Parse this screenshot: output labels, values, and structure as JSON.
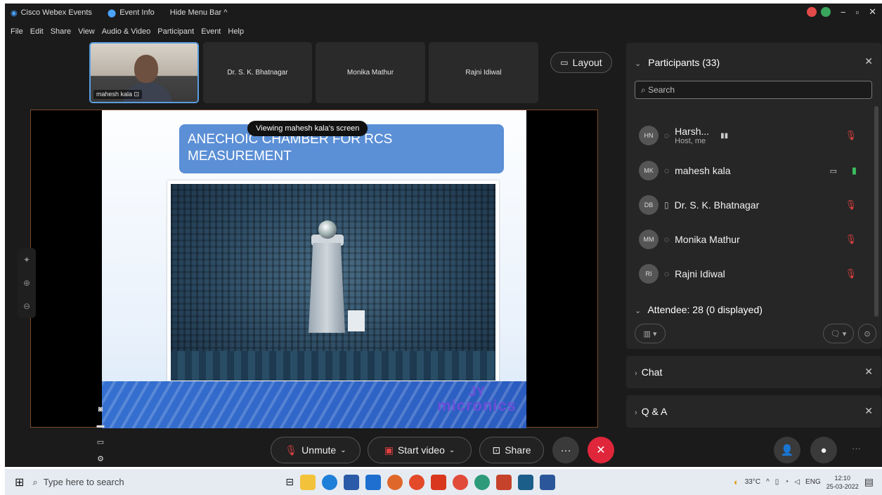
{
  "titlebar": {
    "app_name": "Cisco Webex Events",
    "event_info": "Event Info",
    "hide_menu": "Hide Menu Bar ^",
    "min": "−",
    "max": "▫",
    "close": "✕"
  },
  "menu": [
    "File",
    "Edit",
    "Share",
    "View",
    "Audio & Video",
    "Participant",
    "Event",
    "Help"
  ],
  "video_strip": {
    "self_label": "mahesh kala",
    "tiles": [
      "Dr. S. K. Bhatnagar",
      "Monika Mathur",
      "Rajni Idiwal"
    ],
    "layout_label": "Layout"
  },
  "stage": {
    "tooltip": "Viewing mahesh kala's screen",
    "slide_title": "ANECHOIC CHAMBER FOR RCS MEASUREMENT",
    "logo_line1": "JY",
    "logo_line2": "micronics"
  },
  "controls": {
    "unmute": "Unmute",
    "start_video": "Start video",
    "share": "Share",
    "more": "···",
    "end": "✕"
  },
  "participants": {
    "title": "Participants (33)",
    "search_placeholder": "Search",
    "list": [
      {
        "initials": "HN",
        "name": "Harsh...",
        "sub": "Host, me"
      },
      {
        "initials": "MK",
        "name": "mahesh kala",
        "sub": ""
      },
      {
        "initials": "DB",
        "name": "Dr. S. K. Bhatnagar",
        "sub": ""
      },
      {
        "initials": "MM",
        "name": "Monika Mathur",
        "sub": ""
      },
      {
        "initials": "RI",
        "name": "Rajni Idiwal",
        "sub": ""
      }
    ],
    "attendee_header": "Attendee: 28 (0 displayed)"
  },
  "sections": {
    "chat": "Chat",
    "qa": "Q & A"
  },
  "taskbar": {
    "search_placeholder": "Type here to search",
    "temperature": "33°C",
    "lang": "ENG",
    "time": "12:10",
    "date": "25-03-2022"
  },
  "colors": {
    "end_call": "#e0263a",
    "accent": "#5a9de0",
    "slide_header": "#5b8fd6"
  }
}
